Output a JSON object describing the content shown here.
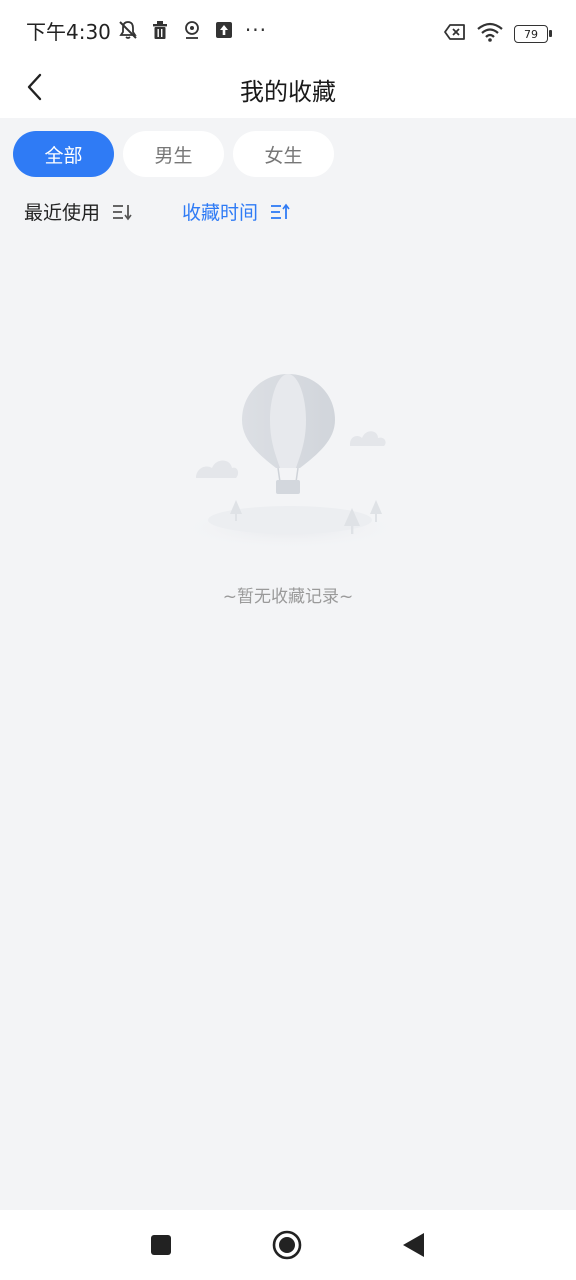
{
  "status_bar": {
    "time": "下午4:30",
    "more": "···",
    "battery": "79",
    "icons": [
      "mute-icon",
      "trash-icon",
      "location-icon",
      "upload-icon",
      "sim-error-icon",
      "wifi-icon",
      "battery-icon"
    ]
  },
  "header": {
    "title": "我的收藏",
    "back_icon": "chevron-left-icon"
  },
  "filters": [
    {
      "label": "全部",
      "active": true
    },
    {
      "label": "男生",
      "active": false
    },
    {
      "label": "女生",
      "active": false
    }
  ],
  "sort": {
    "recent_label": "最近使用",
    "time_label": "收藏时间",
    "active": "time"
  },
  "empty_state": {
    "illustration": "hot-air-balloon-illustration",
    "text": "~暂无收藏记录~"
  },
  "nav": {
    "icons": [
      "recent-apps-icon",
      "home-icon",
      "back-icon"
    ]
  },
  "colors": {
    "accent": "#2f7bf5",
    "background": "#f3f4f6",
    "card": "#ffffff",
    "muted_text": "#9a9a9a"
  }
}
